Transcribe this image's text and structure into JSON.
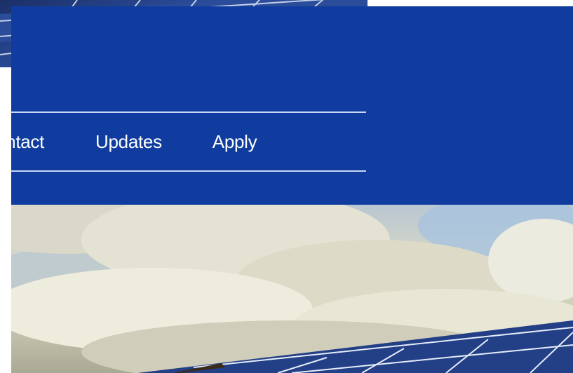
{
  "nav": {
    "items": [
      {
        "label": "ontact"
      },
      {
        "label": "Updates"
      },
      {
        "label": "Apply"
      }
    ]
  },
  "colors": {
    "header_bg": "#0f3c9e",
    "nav_text": "#ffffff",
    "nav_rule": "#c9d6f5"
  },
  "hero": {
    "image": "clouds-and-solar-panels"
  }
}
